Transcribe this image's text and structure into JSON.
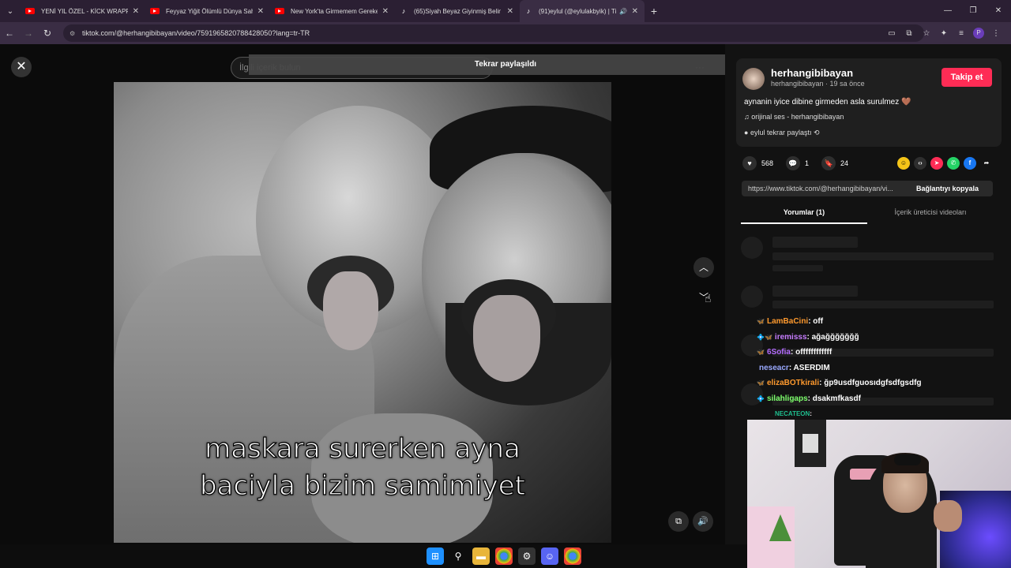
{
  "browser": {
    "tabs": [
      {
        "title": "YENİ YIL ÖZEL - KİCK WRAPPED",
        "icon": "youtube-icon"
      },
      {
        "title": "Feyyaz Yiğit Ölümlü Dünya Sah",
        "icon": "youtube-icon"
      },
      {
        "title": "New York'ta Girmemem Gereke",
        "icon": "youtube-icon"
      },
      {
        "title": "(65)Siyah Beyaz Giyinmiş Belin",
        "icon": "tiktok-icon"
      },
      {
        "title": "(91)eylul (@eylulakbyik) | Ti",
        "icon": "tiktok-icon",
        "active": true
      }
    ],
    "url": "tiktok.com/@herhangibibayan/video/7591965820788428050?lang=tr-TR",
    "profile_initial": "P"
  },
  "viewer": {
    "search_placeholder": "İlgili içerik bulun",
    "toast": "Tekrar paylaşıldı",
    "caption_line1": "maskara surerken ayna",
    "caption_line2": "baciyla bizim samimiyet"
  },
  "panel": {
    "username": "herhangibibayan",
    "subline": "herhangibibayan · 19 sa önce",
    "follow_label": "Takip et",
    "description": "aynanin iyice dibine girmeden asla surulmez 🤎",
    "sound": "orijinal ses - herhangibibayan",
    "repost": "eylul tekrar paylaştı",
    "likes": "568",
    "comments": "1",
    "saves": "24",
    "link": "https://www.tiktok.com/@herhangibibayan/vi...",
    "copy_label": "Bağlantıyı kopyala",
    "tab_comments": "Yorumlar (1)",
    "tab_creator": "İçerik üreticisi videoları"
  },
  "chat": [
    {
      "user": "LamBaCini",
      "message": ": off",
      "color": "#ff9a2e",
      "badge": "🦋"
    },
    {
      "user": "iremisss",
      "message": ": ağağğğğğğğ",
      "color": "#c77dff",
      "badge": "💠🦋"
    },
    {
      "user": "6Sofia",
      "message": ": offffffffffff",
      "color": "#b46cff",
      "badge": "🦋"
    },
    {
      "user": "neseacr",
      "message": ": ASERDIM",
      "color": "#9aa9ff",
      "badge": ""
    },
    {
      "user": "elizaBOTkirali",
      "message": ": ğp9usdfguosıdgfsdfgsdfg",
      "color": "#ff9a2e",
      "badge": "🦋"
    },
    {
      "user": "silahligaps",
      "message": ": dsakmfkasdf",
      "color": "#7cff6b",
      "badge": "💠"
    },
    {
      "user": "NECATEON",
      "message": ":",
      "color": "#1fbf8f",
      "badge": ""
    }
  ]
}
